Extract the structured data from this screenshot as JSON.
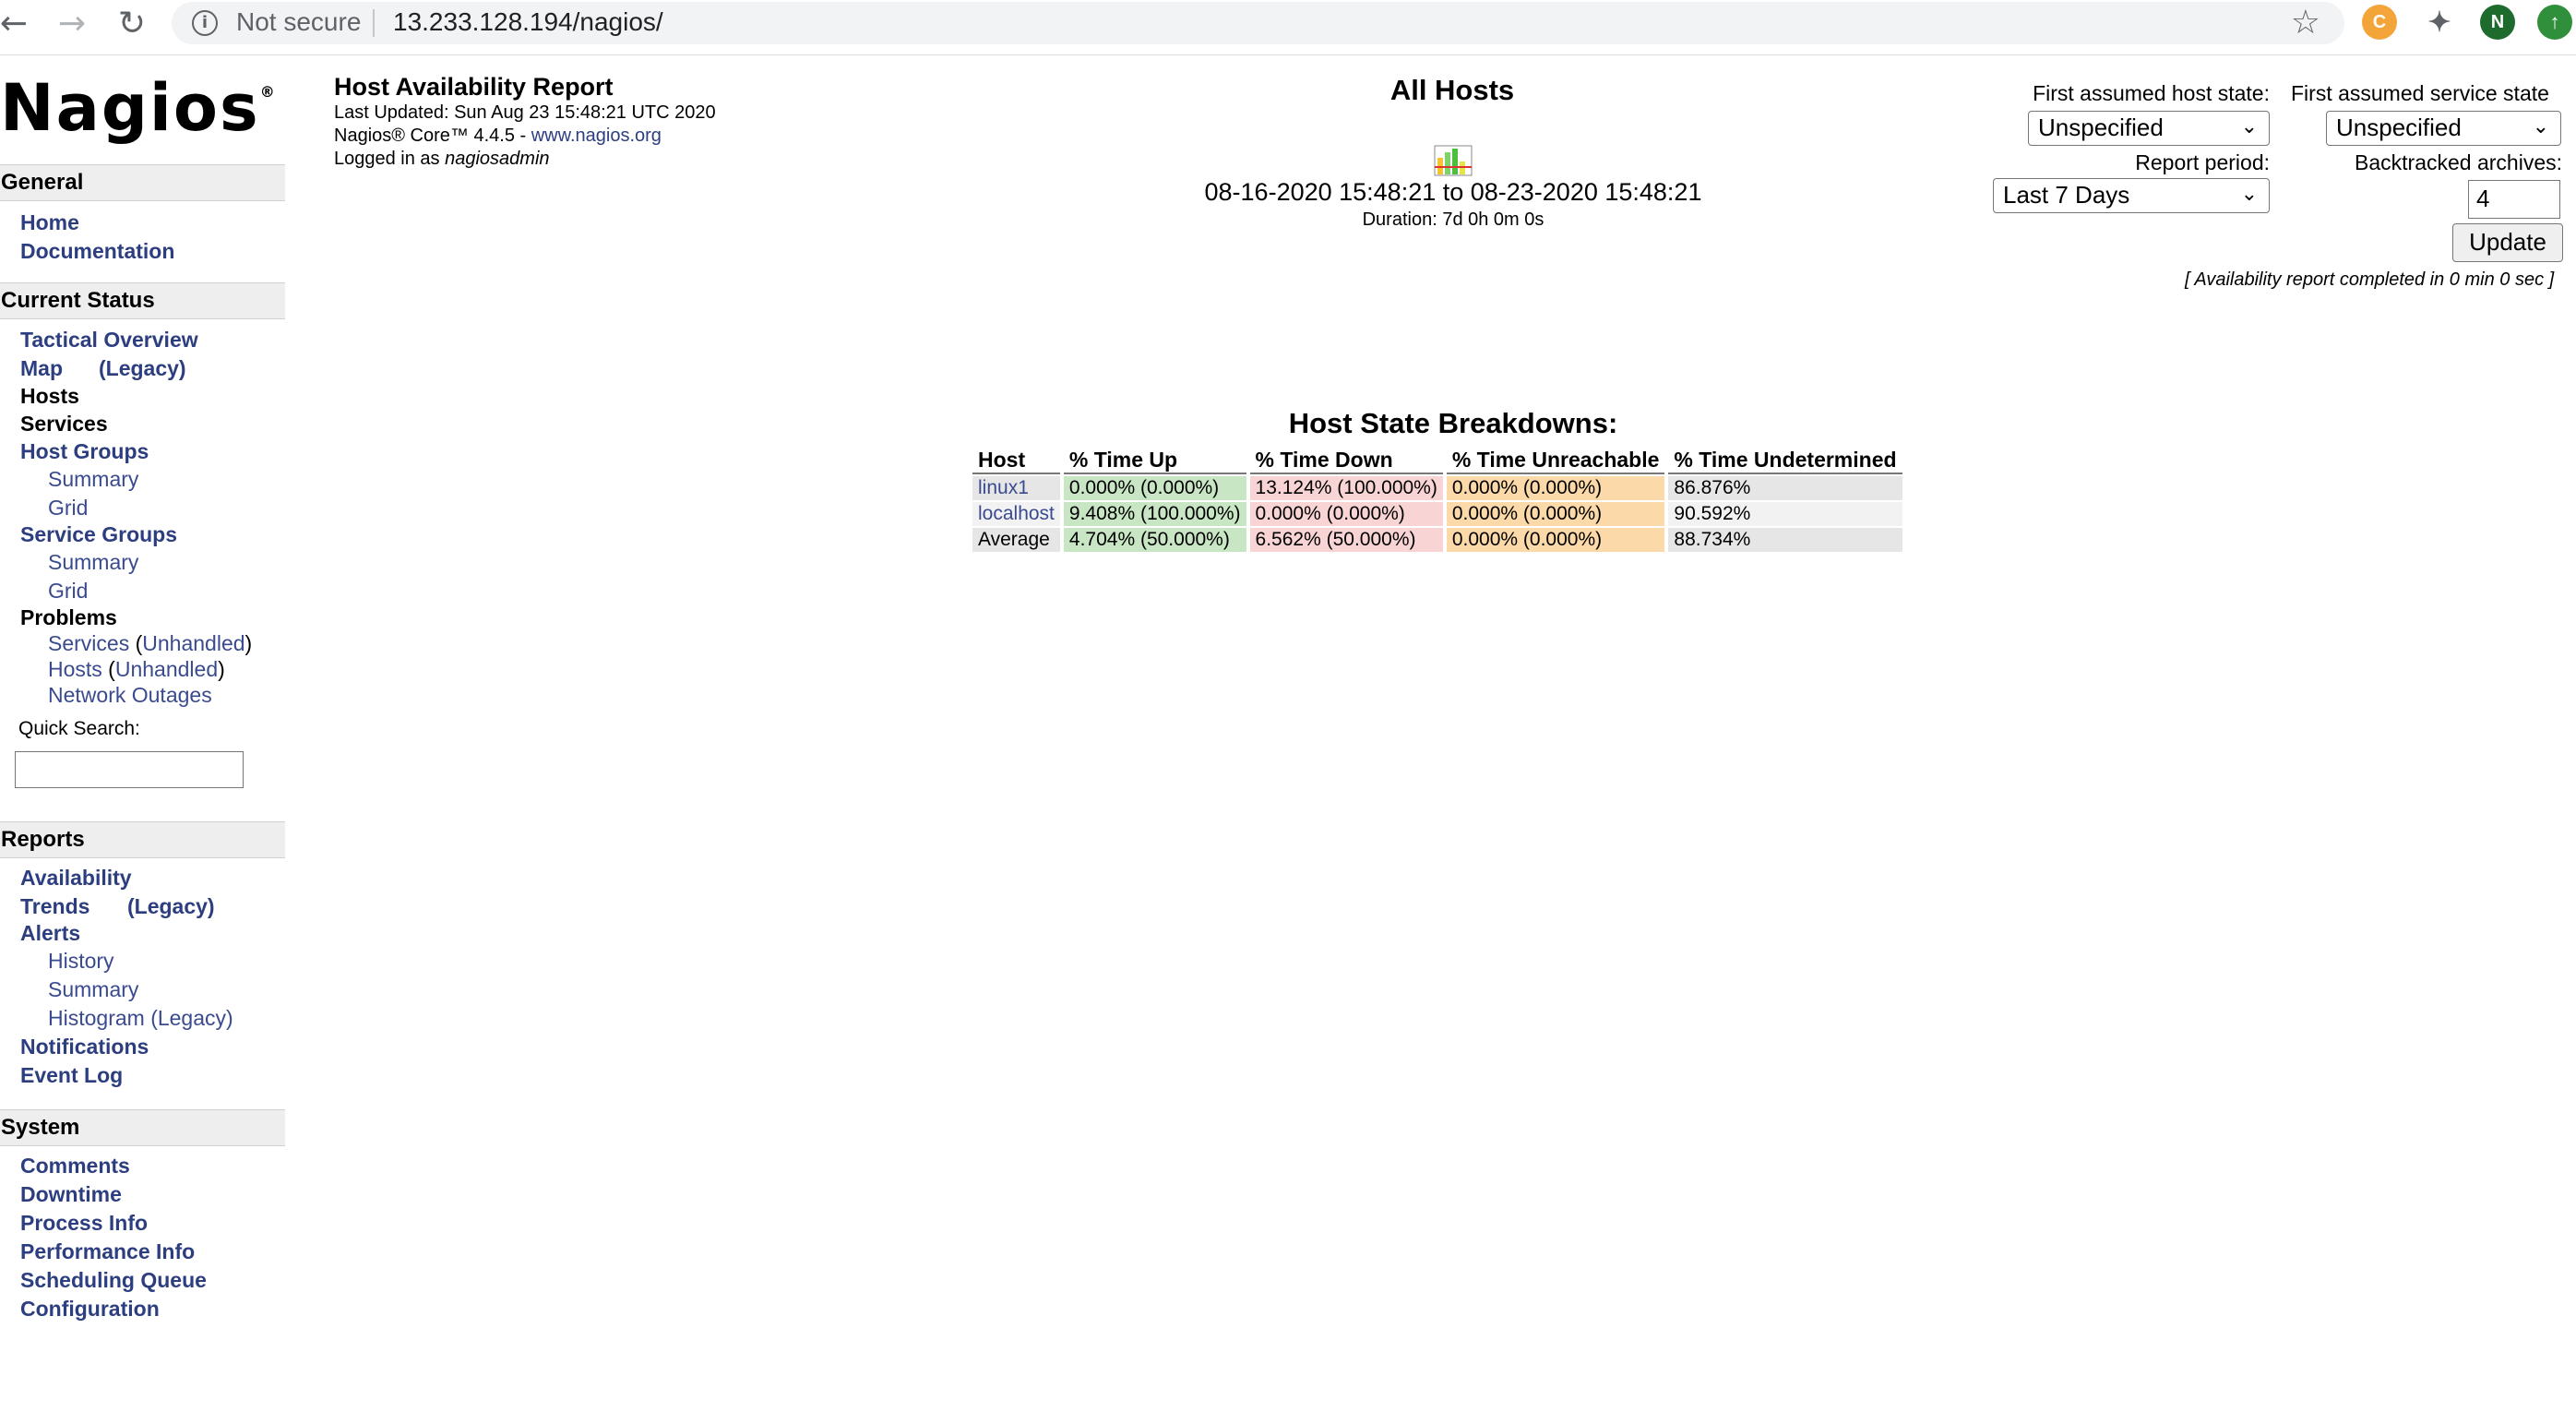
{
  "browser": {
    "security": "Not secure",
    "url": "13.233.128.194/nagios/",
    "profile_initial": "N"
  },
  "sidebar": {
    "logo": "Nagios",
    "logo_mark": "®",
    "sections": {
      "general": "General",
      "current_status": "Current Status",
      "reports": "Reports",
      "system": "System"
    },
    "general": {
      "home": "Home",
      "documentation": "Documentation"
    },
    "current_status": {
      "tactical_overview": "Tactical Overview",
      "map": "Map",
      "map_legacy": "(Legacy)",
      "hosts": "Hosts",
      "services": "Services",
      "host_groups": "Host Groups",
      "hg_summary": "Summary",
      "hg_grid": "Grid",
      "service_groups": "Service Groups",
      "sg_summary": "Summary",
      "sg_grid": "Grid",
      "problems": "Problems",
      "services_p": "Services",
      "unhandled": "Unhandled",
      "hosts_p": "Hosts",
      "network_outages": "Network Outages"
    },
    "quick_search_label": "Quick Search:",
    "reports": {
      "availability": "Availability",
      "trends": "Trends",
      "trends_legacy": "(Legacy)",
      "alerts": "Alerts",
      "history": "History",
      "summary": "Summary",
      "histogram": "Histogram (Legacy)",
      "notifications": "Notifications",
      "event_log": "Event Log"
    },
    "system": {
      "comments": "Comments",
      "downtime": "Downtime",
      "process_info": "Process Info",
      "performance_info": "Performance Info",
      "scheduling_queue": "Scheduling Queue",
      "configuration": "Configuration"
    }
  },
  "report": {
    "title": "Host Availability Report",
    "last_updated": "Last Updated: Sun Aug 23 15:48:21 UTC 2020",
    "core_version": "Nagios® Core™ 4.4.5 - ",
    "core_link": "www.nagios.org",
    "logged_in_prefix": "Logged in as ",
    "logged_in_user": "nagiosadmin",
    "center_title": "All Hosts",
    "period": "08-16-2020 15:48:21 to 08-23-2020 15:48:21",
    "duration": "Duration: 7d 0h 0m 0s"
  },
  "controls": {
    "host_state_label": "First assumed host state:",
    "host_state_value": "Unspecified",
    "service_state_label": "First assumed service state",
    "service_state_value": "Unspecified",
    "report_period_label": "Report period:",
    "report_period_value": "Last 7 Days",
    "backtracked_label": "Backtracked archives:",
    "backtracked_value": "4",
    "update_label": "Update",
    "completed": "[ Availability report completed in 0 min 0 sec ]"
  },
  "breakdown": {
    "title": "Host State Breakdowns:",
    "headers": [
      "Host",
      "% Time Up",
      "% Time Down",
      "% Time Unreachable",
      "% Time Undetermined"
    ],
    "rows": [
      [
        "linux1",
        "0.000% (0.000%)",
        "13.124% (100.000%)",
        "0.000% (0.000%)",
        "86.876%"
      ],
      [
        "localhost",
        "9.408% (100.000%)",
        "0.000% (0.000%)",
        "0.000% (0.000%)",
        "90.592%"
      ],
      [
        "Average",
        "4.704% (50.000%)",
        "6.562% (50.000%)",
        "0.000% (0.000%)",
        "88.734%"
      ]
    ]
  },
  "colors": {
    "link": "#2c3e7f",
    "up": "#c8e6c4",
    "down": "#f8d4d4",
    "unreachable": "#fcd9a8",
    "undetermined": "#e6e6e6"
  }
}
